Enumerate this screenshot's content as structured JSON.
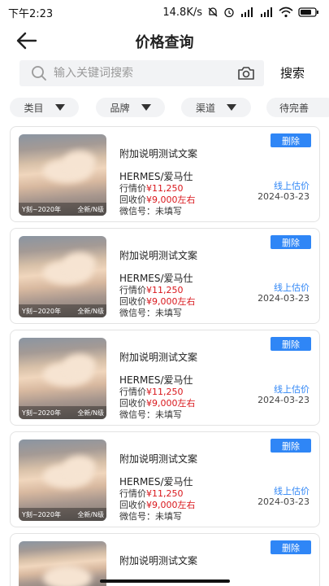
{
  "status_bar": {
    "time": "下午2:23",
    "net_speed": "14.8K/s",
    "signal_icons": [
      "mute-bell-icon",
      "alarm-icon",
      "signal-hd-icon",
      "signal-hd-icon",
      "wifi-icon",
      "battery-icon"
    ]
  },
  "header": {
    "title": "价格查询",
    "back_icon": "arrow-left-icon"
  },
  "search": {
    "placeholder": "输入关键词搜索",
    "value": "",
    "search_label": "搜索"
  },
  "filters": [
    {
      "label": "类目"
    },
    {
      "label": "品牌"
    },
    {
      "label": "渠道"
    },
    {
      "label": "待完善"
    }
  ],
  "items": [
    {
      "caption_left": "Y刻~2020年",
      "caption_right": "全新/N级",
      "description": "附加说明测试文案",
      "brand": "HERMES/爱马仕",
      "market_label": "行情价",
      "market_price": "¥11,250",
      "recycle_label": "回收价",
      "recycle_price": "¥9,000左右",
      "wechat": "微信号：未填写",
      "delete_label": "删除",
      "online_label": "线上估价",
      "date": "2024-03-23"
    },
    {
      "caption_left": "Y刻~2020年",
      "caption_right": "全新/N级",
      "description": "附加说明测试文案",
      "brand": "HERMES/爱马仕",
      "market_label": "行情价",
      "market_price": "¥11,250",
      "recycle_label": "回收价",
      "recycle_price": "¥9,000左右",
      "wechat": "微信号：未填写",
      "delete_label": "删除",
      "online_label": "线上估价",
      "date": "2024-03-23"
    },
    {
      "caption_left": "Y刻~2020年",
      "caption_right": "全新/N级",
      "description": "附加说明测试文案",
      "brand": "HERMES/爱马仕",
      "market_label": "行情价",
      "market_price": "¥11,250",
      "recycle_label": "回收价",
      "recycle_price": "¥9,000左右",
      "wechat": "微信号：未填写",
      "delete_label": "删除",
      "online_label": "线上估价",
      "date": "2024-03-23"
    },
    {
      "caption_left": "Y刻~2020年",
      "caption_right": "全新/N级",
      "description": "附加说明测试文案",
      "brand": "HERMES/爱马仕",
      "market_label": "行情价",
      "market_price": "¥11,250",
      "recycle_label": "回收价",
      "recycle_price": "¥9,000左右",
      "wechat": "微信号：未填写",
      "delete_label": "删除",
      "online_label": "线上估价",
      "date": "2024-03-23"
    },
    {
      "description": "附加说明测试文案",
      "delete_label": "删除"
    }
  ],
  "colors": {
    "accent": "#2f86f6",
    "price_red": "#d9171c",
    "chip_bg": "#f2f3f5",
    "card_border": "#e3e3e3"
  }
}
